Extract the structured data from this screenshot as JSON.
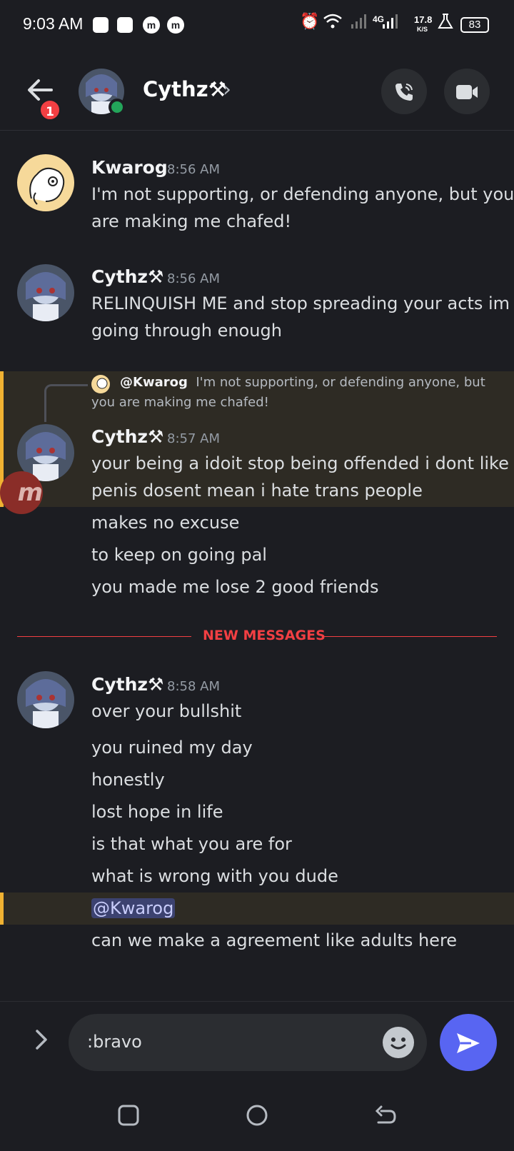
{
  "status_bar": {
    "time": "9:03 AM",
    "network": "4G",
    "speed": "17.8",
    "speed_unit": "K/S",
    "battery": "83",
    "icons": [
      "alarm-icon",
      "wifi-icon",
      "signal-icon",
      "signal-4g-icon",
      "flask-icon"
    ]
  },
  "header": {
    "unread_count": "1",
    "title": "Cythz⚒",
    "chevron": "›",
    "call_icon": "phone-icon",
    "video_icon": "video-camera-icon"
  },
  "messages": [
    {
      "author": "Kwarog",
      "time": "8:56 AM",
      "lines": [
        "I'm not supporting, or defending anyone, but you",
        "are making me chafed!"
      ]
    },
    {
      "author": "Cythz⚒",
      "time": "8:56 AM",
      "lines": [
        "RELINQUISH ME and stop spreading your acts im",
        "going through enough"
      ]
    },
    {
      "reply_author": "@Kwarog",
      "reply_text": "I'm not supporting, or defending anyone, but you are making me chafed!",
      "author": "Cythz⚒",
      "time": "8:57 AM",
      "lines": [
        "your being a idoit stop being offended i dont like",
        "penis dosent mean i hate trans people"
      ],
      "followups": [
        "makes no excuse",
        "to keep on going pal",
        "you made me lose 2 good friends"
      ]
    },
    {
      "author": "Cythz⚒",
      "time": "8:58 AM",
      "lines": [
        "over your bullshit"
      ],
      "followups": [
        "you ruined my day",
        "honestly",
        "lost hope in life",
        "is that what you are for",
        "what is wrong with you dude",
        "@Kwarog",
        "can we make  a agreement like adults here"
      ]
    }
  ],
  "new_messages_label": "NEW MESSAGES",
  "floating_badge": "m",
  "composer": {
    "value": ":bravo",
    "expand_icon": "chevron-right-icon",
    "emoji_icon": "emoji-smile-icon",
    "send_icon": "send-arrow-icon"
  },
  "nav": {
    "icons": [
      "recent-apps-icon",
      "home-icon",
      "back-icon"
    ]
  },
  "colors": {
    "background": "#1c1d22",
    "online": "#23a55a",
    "unread": "#f23f43",
    "mention_highlight": "#f0b232",
    "brand": "#5865f2"
  }
}
